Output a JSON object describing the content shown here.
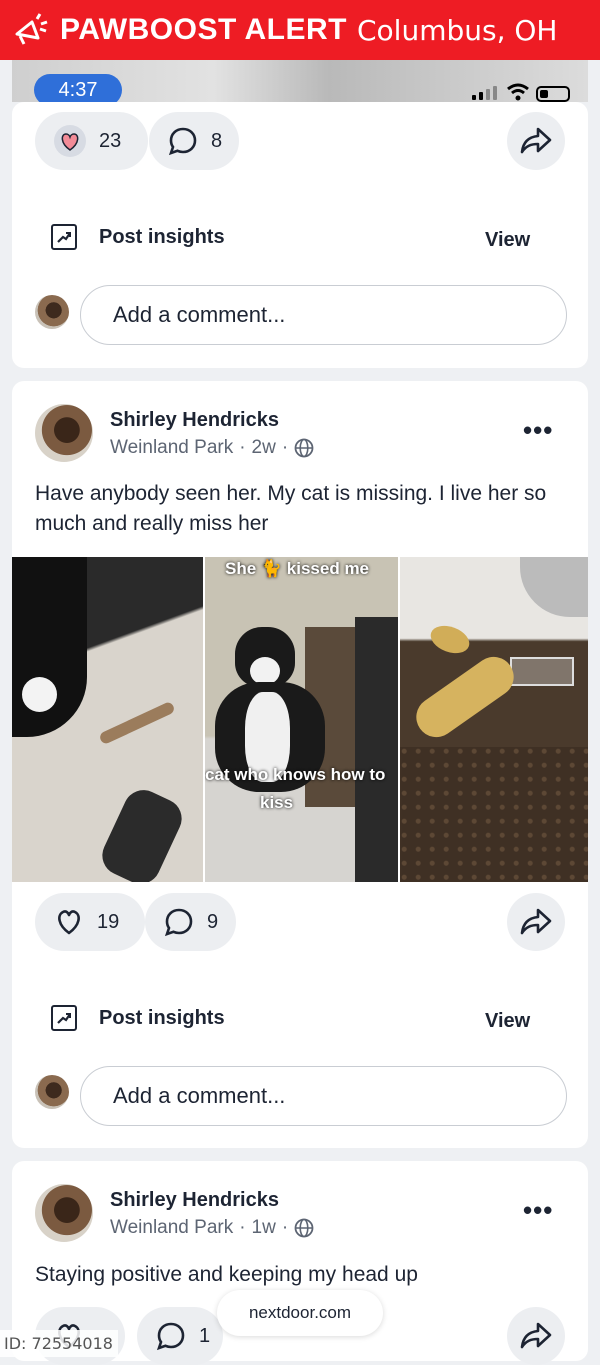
{
  "banner": {
    "brand": "PAWBOOST ALERT",
    "location": "Columbus, OH",
    "color": "#ee1c24"
  },
  "status_bar": {
    "time": "4:37"
  },
  "post_top": {
    "likes": "23",
    "comments": "8",
    "insights_label": "Post insights",
    "view_label": "View",
    "comment_placeholder": "Add a comment..."
  },
  "post_1": {
    "author": "Shirley Hendricks",
    "neighborhood": "Weinland Park",
    "age": "2w",
    "text": "Have anybody seen her. My cat is missing. I live her so much and really miss her",
    "photo_captions": [
      "She 🐈 kissed me",
      "cat who knows how to",
      "kiss"
    ],
    "likes": "19",
    "comments": "9",
    "insights_label": "Post insights",
    "view_label": "View",
    "comment_placeholder": "Add a comment..."
  },
  "post_2": {
    "author": "Shirley Hendricks",
    "neighborhood": "Weinland Park",
    "age": "1w",
    "text": "Staying positive and keeping my head up",
    "comments": "1"
  },
  "footer": {
    "site": "nextdoor.com",
    "id_label": "ID: 72554018"
  },
  "icons": [
    "megaphone-icon",
    "heart-icon",
    "comment-icon",
    "share-icon",
    "insights-icon",
    "globe-icon",
    "more-icon"
  ]
}
